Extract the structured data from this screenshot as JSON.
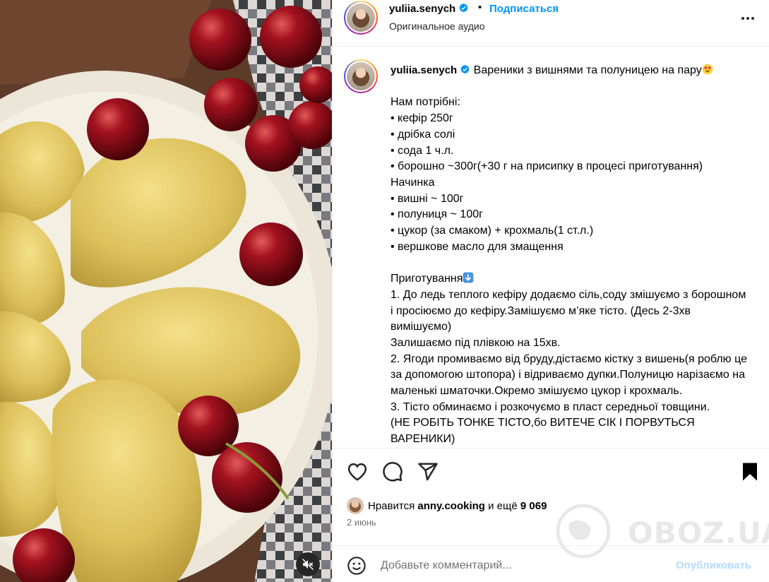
{
  "header": {
    "username": "yuliia.senych",
    "separator": "•",
    "follow_label": "Подписаться",
    "audio_label": "Оригинальное аудио"
  },
  "caption": {
    "username": "yuliia.senych",
    "title": "Вареники з вишнями та полуницею на пару",
    "body": "\nНам потрібні:\n• кефір 250г\n• дрібка солі\n• сода 1 ч.л.\n• борошно ~300г(+30 г на присипку в процесі приготування)\nНачинка\n• вишні ~ 100г\n• полуниця ~ 100г\n• цукор (за смаком) + крохмаль(1 ст.л.)\n• вершкове масло для змащення\n\nПриготування",
    "steps": "1. До ледь теплого кефіру додаємо сіль,соду змішуємо з борошном і просіюємо до кефіру.Замішуємо м’яке тісто. (Десь 2-3хв вимішуємо)\nЗалишаємо під плівкою на 15хв.\n2. Ягоди промиваємо від бруду,дістаємо кістку з вишень(я роблю це за допомогою штопора) і відриваємо дупки.Полуницю нарізаємо на маленькі шматочки.Окремо змішуємо цукор і крохмаль.\n3. Тісто обминаємо і розкочуємо в пласт середньої товщини.\n(НЕ РОБІТЬ ТОНКЕ ТІСТО,бо ВИТЕЧЕ СІК І ПОРВУТЬСЯ ВАРЕНИКИ)"
  },
  "likes": {
    "prefix": "Нравится",
    "user": "anny.cooking",
    "middle": "и ещё",
    "count": "9 069"
  },
  "date": "2 июнь",
  "comment": {
    "placeholder": "Добавьте комментарий...",
    "publish_label": "Опубликовать"
  },
  "watermark": "OBOZ.UA",
  "colors": {
    "accent": "#0095f6",
    "publish_disabled": "#b3dbff",
    "muted": "#737373"
  }
}
